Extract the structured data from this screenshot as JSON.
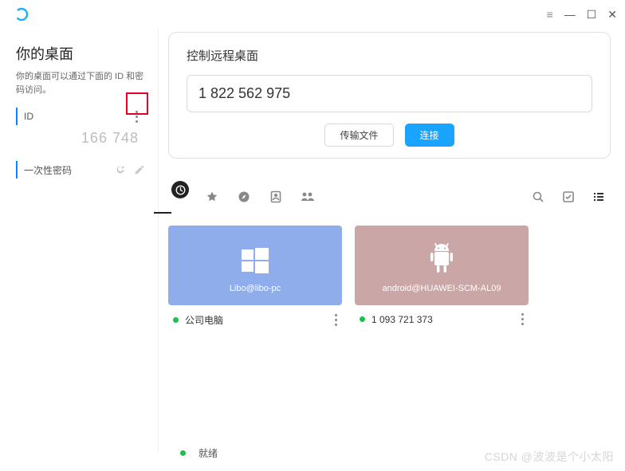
{
  "window": {
    "hamburger": "≡",
    "min": "—",
    "max": "☐",
    "close": "✕"
  },
  "sidebar": {
    "title": "你的桌面",
    "subtitle": "你的桌面可以通过下面的 ID 和密码访问。",
    "id_label": "ID",
    "id_value": "166 748",
    "pw_label": "一次性密码"
  },
  "remote": {
    "title": "控制远程桌面",
    "input_value": "1 822 562 975",
    "transfer_btn": "传输文件",
    "connect_btn": "连接"
  },
  "cards": [
    {
      "top_label": "Libo@libo-pc",
      "name": "公司电脑"
    },
    {
      "top_label": "android@HUAWEI-SCM-AL09",
      "name": "1 093 721 373"
    }
  ],
  "status": {
    "text": "就绪"
  },
  "watermark": "CSDN @波波是个小太阳"
}
